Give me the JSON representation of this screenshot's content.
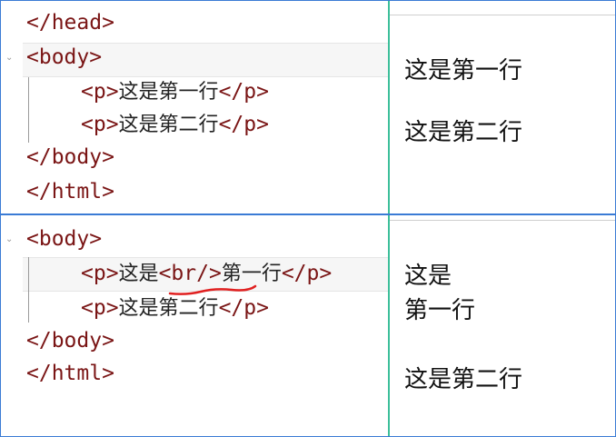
{
  "top": {
    "code": {
      "head_close": "</head>",
      "body_open": "<body>",
      "p1": {
        "open": "<p>",
        "text": "这是第一行",
        "close": "</p>"
      },
      "p2": {
        "open": "<p>",
        "text": "这是第二行",
        "close": "</p>"
      },
      "body_close": "</body>",
      "html_close": "</html>"
    },
    "preview": {
      "line1": "这是第一行",
      "line2": "这是第二行"
    }
  },
  "bottom": {
    "code": {
      "body_open": "<body>",
      "p1": {
        "open": "<p>",
        "text_before": "这是",
        "br": "<br/>",
        "text_after": "第一行",
        "close": "</p>"
      },
      "p2": {
        "open": "<p>",
        "text": "这是第二行",
        "close": "</p>"
      },
      "body_close": "</body>",
      "html_close": "</html>"
    },
    "preview": {
      "line1a": "这是",
      "line1b": "第一行",
      "line2": "这是第二行"
    }
  },
  "colors": {
    "tag": "#7a1515",
    "border": "#3a7bd5",
    "split": "#3dbf9a",
    "squiggle": "#e02020"
  }
}
